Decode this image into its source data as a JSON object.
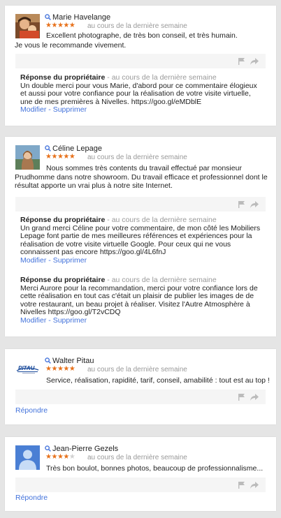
{
  "colors": {
    "star": "#e7711b",
    "link": "#4272db",
    "muted": "#999999"
  },
  "reviews": [
    {
      "name": "Marie Havelange",
      "rating": 5,
      "date": "au cours de la dernière semaine",
      "text1": "Excellent photographe, de très bon conseil, et très humain.",
      "text2": "Je vous le recommande vivement.",
      "reply": {
        "title": "Réponse du propriétaire",
        "date": "- au cours de la dernière semaine",
        "text": "Un double merci pour vous Marie, d'abord pour ce commentaire élogieux et aussi pour votre confiance pour la réalisation de votre visite virtuelle, une de mes premières à Nivelles. https://goo.gl/eMDblE",
        "edit": "Modifier",
        "sep": " - ",
        "delete": "Supprimer"
      }
    },
    {
      "name": "Céline Lepage",
      "rating": 5,
      "date": "au cours de la dernière semaine",
      "text1": "Nous sommes très contents du travail effectué par monsieur",
      "text2": "Prudhomme dans notre showroom. Du travail efficace et professionnel dont le résultat apporte un vrai plus à notre site Internet.",
      "replies": [
        {
          "title": "Réponse du propriétaire",
          "date": "- au cours de la dernière semaine",
          "text": "Un grand merci Céline pour votre commentaire, de mon côté les Mobiliers Lepage font partie de mes meilleures références et expériences pour la réalisation de votre visite virtuelle Google. Pour ceux qui ne vous connaissent pas encore https://goo.gl/4L6fnJ",
          "edit": "Modifier",
          "sep": " - ",
          "delete": "Supprimer"
        },
        {
          "title": "Réponse du propriétaire",
          "date": "- au cours de la dernière semaine",
          "text": "Merci Aurore pour la recommandation, merci pour votre confiance lors de cette réalisation en tout cas c'était un plaisir de publier les images de de votre restaurant, un beau projet à réaliser. Visitez l'Autre Atmosphère à Nivelles https://goo.gl/T2vCDQ",
          "edit": "Modifier",
          "sep": " - ",
          "delete": "Supprimer"
        }
      ]
    },
    {
      "name": "Walter Pitau",
      "rating": 5,
      "date": "au cours de la dernière semaine",
      "text1": "Service, réalisation, rapidité, tarif, conseil, amabilité : tout est au top !",
      "reply_link": "Répondre"
    },
    {
      "name": "Jean-Pierre Gezels",
      "rating": 4,
      "date": "au cours de la dernière semaine",
      "text1": "Très bon boulot, bonnes photos, beaucoup de professionnalisme...",
      "reply_link": "Répondre"
    }
  ]
}
